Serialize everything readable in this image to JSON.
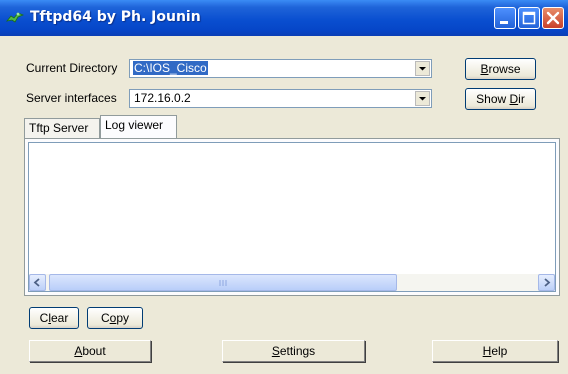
{
  "window": {
    "title": "Tftpd64 by Ph. Jounin"
  },
  "fields": {
    "current_directory_label": "Current Directory",
    "current_directory_value": "C:\\IOS_Cisco",
    "server_interfaces_label": "Server interfaces",
    "server_interfaces_value": "172.16.0.2"
  },
  "buttons": {
    "browse_pre": "",
    "browse_key": "B",
    "browse_post": "rowse",
    "showdir_pre": "Show ",
    "showdir_key": "D",
    "showdir_post": "ir",
    "clear_pre": "C",
    "clear_key": "l",
    "clear_post": "ear",
    "copy_pre": "C",
    "copy_key": "o",
    "copy_post": "py",
    "about_pre": "",
    "about_key": "A",
    "about_post": "bout",
    "settings_pre": "",
    "settings_key": "S",
    "settings_post": "ettings",
    "help_pre": "",
    "help_key": "H",
    "help_post": "elp"
  },
  "tabs": [
    {
      "label": "Tftp Server",
      "active": false
    },
    {
      "label": "Log viewer",
      "active": true
    }
  ],
  "colors": {
    "titlebar": "#0a4fd0",
    "selection": "#316ac5",
    "close_button": "#c8402a"
  },
  "icons": {
    "app": "tftpd-app-icon",
    "minimize": "minimize-icon",
    "maximize": "maximize-icon",
    "close": "close-icon",
    "dropdown": "chevron-down-icon",
    "scroll_left": "chevron-left-icon",
    "scroll_right": "chevron-right-icon"
  }
}
